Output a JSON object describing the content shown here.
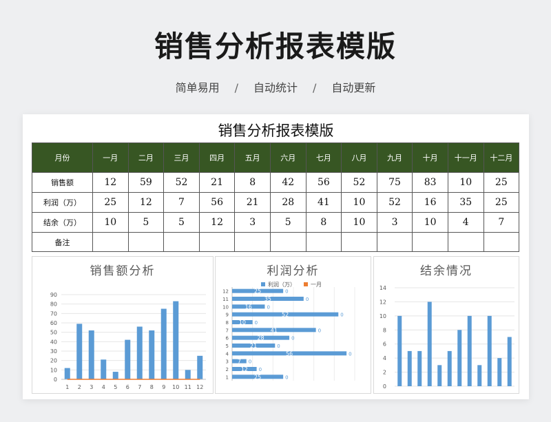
{
  "header": {
    "title": "销售分析报表模版",
    "tags": [
      "简单易用",
      "自动统计",
      "自动更新"
    ],
    "separator": "/"
  },
  "sheet": {
    "title": "销售分析报表模版",
    "columns": [
      "月份",
      "一月",
      "二月",
      "三月",
      "四月",
      "五月",
      "六月",
      "七月",
      "八月",
      "九月",
      "十月",
      "十一月",
      "十二月"
    ],
    "rows": [
      {
        "label": "销售额",
        "values": [
          "12",
          "59",
          "52",
          "21",
          "8",
          "42",
          "56",
          "52",
          "75",
          "83",
          "10",
          "25"
        ]
      },
      {
        "label": "利润（万）",
        "values": [
          "25",
          "12",
          "7",
          "56",
          "21",
          "28",
          "41",
          "10",
          "52",
          "16",
          "35",
          "25"
        ]
      },
      {
        "label": "结余（万）",
        "values": [
          "10",
          "5",
          "5",
          "12",
          "3",
          "5",
          "8",
          "10",
          "3",
          "10",
          "4",
          "7"
        ]
      },
      {
        "label": "备注",
        "values": [
          "",
          "",
          "",
          "",
          "",
          "",
          "",
          "",
          "",
          "",
          "",
          ""
        ]
      }
    ]
  },
  "colors": {
    "header_green": "#375623",
    "bar_blue": "#5b9bd5",
    "line_orange": "#ed7d31"
  },
  "chart_data": [
    {
      "type": "bar",
      "title": "销售额分析",
      "categories": [
        "1",
        "2",
        "3",
        "4",
        "5",
        "6",
        "7",
        "8",
        "9",
        "10",
        "11",
        "12"
      ],
      "series": [
        {
          "values": [
            12,
            59,
            52,
            21,
            8,
            42,
            56,
            52,
            75,
            83,
            10,
            25
          ]
        },
        {
          "values": [
            0,
            0,
            0,
            0,
            0,
            0,
            0,
            0,
            0,
            0,
            0,
            0
          ]
        }
      ],
      "yticks": [
        "0",
        "10",
        "20",
        "30",
        "40",
        "50",
        "60",
        "70",
        "80",
        "90"
      ],
      "ylim": [
        0,
        90
      ],
      "grid": true
    },
    {
      "type": "bar",
      "orientation": "horizontal",
      "title": "利润分析",
      "categories": [
        "1",
        "2",
        "3",
        "4",
        "5",
        "6",
        "7",
        "8",
        "9",
        "10",
        "11",
        "12"
      ],
      "series": [
        {
          "name": "利润（万）",
          "values": [
            25,
            12,
            7,
            56,
            21,
            28,
            41,
            10,
            52,
            16,
            35,
            25
          ]
        },
        {
          "name": "一月",
          "values": [
            0,
            0,
            0,
            0,
            0,
            0,
            0,
            0,
            0,
            0,
            0,
            0
          ]
        }
      ],
      "legend": "top",
      "grid": true
    },
    {
      "type": "bar",
      "title": "结余情况",
      "categories": [
        "1",
        "2",
        "3",
        "4",
        "5",
        "6",
        "7",
        "8",
        "9",
        "10",
        "11",
        "12"
      ],
      "series": [
        {
          "values": [
            10,
            5,
            5,
            12,
            3,
            5,
            8,
            10,
            3,
            10,
            4,
            7
          ]
        }
      ],
      "yticks": [
        "0",
        "2",
        "4",
        "6",
        "8",
        "10",
        "12",
        "14"
      ],
      "ylim": [
        0,
        14
      ],
      "grid": true
    }
  ]
}
